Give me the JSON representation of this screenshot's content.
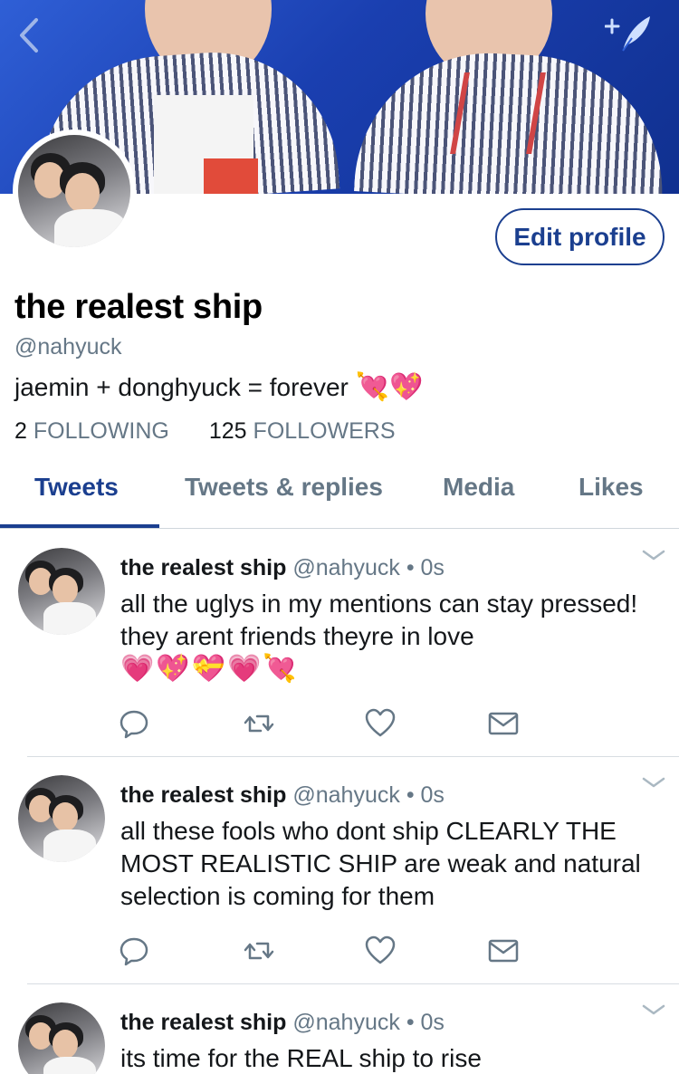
{
  "profile": {
    "display_name": "the realest ship",
    "handle": "@nahyuck",
    "bio_text": "jaemin + donghyuck = forever",
    "bio_emojis": "💘💖",
    "edit_profile_label": "Edit profile",
    "following_count": "2",
    "following_label": "FOLLOWING",
    "followers_count": "125",
    "followers_label": "FOLLOWERS"
  },
  "header": {
    "back_icon": "chevron-left-icon",
    "compose_icon": "compose-tweet-icon"
  },
  "tabs": [
    {
      "label": "Tweets",
      "active": true
    },
    {
      "label": "Tweets & replies",
      "active": false
    },
    {
      "label": "Media",
      "active": false
    },
    {
      "label": "Likes",
      "active": false
    }
  ],
  "tweets": [
    {
      "name": "the realest ship",
      "handle": "@nahyuck",
      "dot": "•",
      "time": "0s",
      "text": "all the uglys in my mentions can stay pressed! they arent friends theyre in love",
      "emojis": "💗💖💝💗💘"
    },
    {
      "name": "the realest ship",
      "handle": "@nahyuck",
      "dot": "•",
      "time": "0s",
      "text": "all these fools who dont ship CLEARLY THE MOST REALISTIC SHIP are weak and natural selection is coming for them",
      "emojis": ""
    },
    {
      "name": "the realest ship",
      "handle": "@nahyuck",
      "dot": "•",
      "time": "0s",
      "text": "its time for the REAL ship to rise",
      "emojis": ""
    }
  ],
  "colors": {
    "accent": "#1b3f8f",
    "muted": "#657786",
    "text": "#14171a"
  }
}
